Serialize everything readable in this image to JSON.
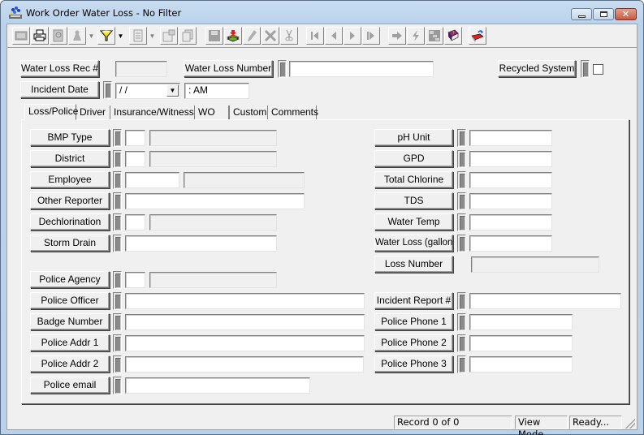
{
  "window": {
    "title": "Work Order Water Loss - No Filter",
    "controls": {
      "minimize": "minimize",
      "maximize": "maximize",
      "close": "✕"
    }
  },
  "toolbar": {
    "buttons": [
      {
        "name": "form-view-icon",
        "enabled": false
      },
      {
        "name": "print-icon",
        "enabled": true
      },
      {
        "name": "print-preview-icon",
        "enabled": false
      },
      {
        "name": "find-icon",
        "enabled": false,
        "dropdown": true
      },
      {
        "name": "filter-icon",
        "enabled": true,
        "dropdown": true
      },
      {
        "name": "report-icon",
        "enabled": false,
        "dropdown": true
      },
      {
        "name": "properties-icon",
        "enabled": false
      },
      {
        "name": "copy-record-icon",
        "enabled": false
      },
      {
        "name": "save-icon",
        "enabled": false
      },
      {
        "name": "add-record-icon",
        "enabled": true
      },
      {
        "name": "edit-icon",
        "enabled": false
      },
      {
        "name": "delete-icon",
        "enabled": false
      },
      {
        "name": "cut-icon",
        "enabled": false
      },
      {
        "name": "first-record-icon",
        "enabled": false
      },
      {
        "name": "previous-record-icon",
        "enabled": false
      },
      {
        "name": "next-record-icon",
        "enabled": false
      },
      {
        "name": "last-record-icon",
        "enabled": false
      },
      {
        "name": "goto-icon",
        "enabled": false
      },
      {
        "name": "lightning-icon",
        "enabled": false
      },
      {
        "name": "hierarchy-icon",
        "enabled": false
      },
      {
        "name": "help-book-icon",
        "enabled": true
      },
      {
        "name": "exit-icon",
        "enabled": true
      }
    ]
  },
  "header": {
    "water_loss_rec_label": "Water Loss Rec #",
    "water_loss_rec_value": "",
    "water_loss_number_label": "Water Loss Number",
    "water_loss_number_value": "",
    "recycled_system_label": "Recycled System",
    "recycled_system_checked": false,
    "incident_date_label": "Incident Date",
    "incident_date_value": " /  /",
    "incident_time_value": " :  AM"
  },
  "tabs": [
    {
      "label": "Loss/Police",
      "active": true
    },
    {
      "label": "Driver",
      "active": false
    },
    {
      "label": "Insurance/Witness",
      "active": false
    },
    {
      "label": "WO",
      "active": false
    },
    {
      "label": "Custom",
      "active": false
    },
    {
      "label": "Comments",
      "active": false
    }
  ],
  "left_fields": [
    {
      "label": "BMP Type",
      "code": "",
      "description": ""
    },
    {
      "label": "District",
      "code": "",
      "description": ""
    },
    {
      "label": "Employee",
      "code": "",
      "description": ""
    },
    {
      "label": "Other Reporter",
      "value": ""
    },
    {
      "label": "Dechlorination",
      "code": "",
      "description": ""
    },
    {
      "label": "Storm Drain",
      "value": ""
    },
    {
      "label": "Police Agency",
      "code": "",
      "description": ""
    },
    {
      "label": "Police Officer",
      "value": ""
    },
    {
      "label": "Badge Number",
      "value": ""
    },
    {
      "label": "Police Addr 1",
      "value": ""
    },
    {
      "label": "Police Addr 2",
      "value": ""
    },
    {
      "label": "Police email",
      "value": ""
    }
  ],
  "right_fields": [
    {
      "label": "pH Unit",
      "value": ""
    },
    {
      "label": "GPD",
      "value": ""
    },
    {
      "label": "Total Chlorine",
      "value": ""
    },
    {
      "label": "TDS",
      "value": ""
    },
    {
      "label": "Water Temp",
      "value": ""
    },
    {
      "label": "Water Loss (gallons)",
      "value": ""
    },
    {
      "label": "Loss Number",
      "value": ""
    },
    {
      "label": "Incident Report #",
      "value": ""
    },
    {
      "label": "Police Phone 1",
      "value": ""
    },
    {
      "label": "Police Phone 2",
      "value": ""
    },
    {
      "label": "Police Phone 3",
      "value": ""
    }
  ],
  "status": {
    "record": "Record 0 of 0",
    "mode": "View Mode",
    "state": "Ready..."
  }
}
